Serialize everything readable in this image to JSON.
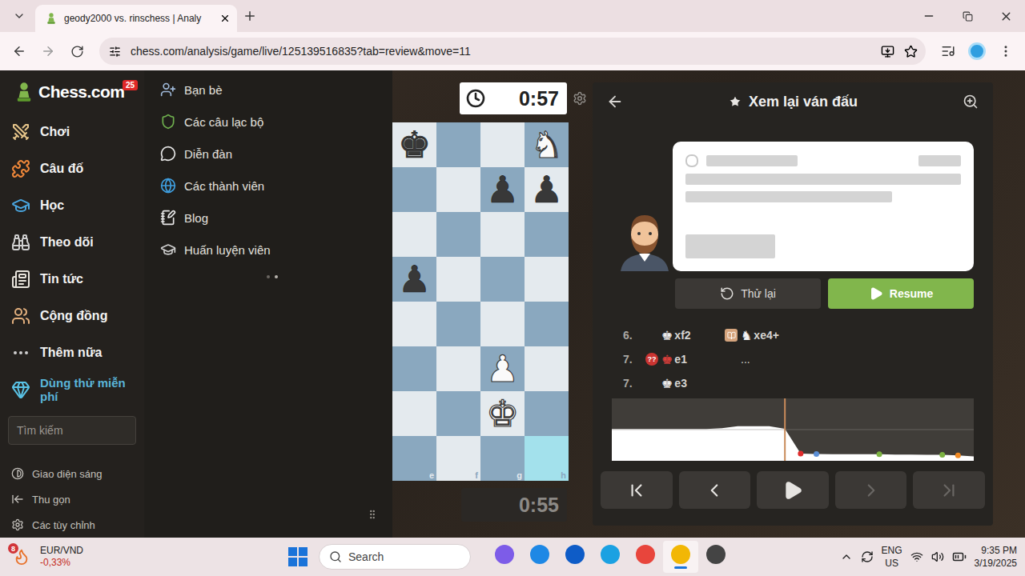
{
  "browser": {
    "tab": {
      "title": "geody2000 vs. rinschess | Analy"
    },
    "url": "chess.com/analysis/game/live/125139516835?tab=review&move=11"
  },
  "sidebar": {
    "logo": "Chess.com",
    "badge": "25",
    "items": [
      {
        "label": "Chơi"
      },
      {
        "label": "Câu đố"
      },
      {
        "label": "Học"
      },
      {
        "label": "Theo dõi"
      },
      {
        "label": "Tin tức"
      },
      {
        "label": "Cộng đồng"
      },
      {
        "label": "Thêm nữa"
      }
    ],
    "trial": "Dùng thử miễn phí",
    "search_placeholder": "Tìm kiếm",
    "footer": [
      {
        "label": "Giao diện sáng"
      },
      {
        "label": "Thu gọn"
      },
      {
        "label": "Các tùy chỉnh"
      }
    ]
  },
  "submenu": [
    {
      "label": "Bạn bè"
    },
    {
      "label": "Các câu lạc bộ"
    },
    {
      "label": "Diễn đàn"
    },
    {
      "label": "Các thành viên"
    },
    {
      "label": "Blog"
    },
    {
      "label": "Huấn luyện viên"
    }
  ],
  "clocks": {
    "top": "0:57",
    "bottom": "0:55"
  },
  "board": {
    "files": [
      "e",
      "f",
      "g",
      "h"
    ],
    "highlight": [
      "h1"
    ],
    "pieces": [
      {
        "square": "e8",
        "glyph": "♚",
        "side": "black"
      },
      {
        "square": "h8",
        "glyph": "♞",
        "side": "white"
      },
      {
        "square": "g7",
        "glyph": "♟",
        "side": "black"
      },
      {
        "square": "h7",
        "glyph": "♟",
        "side": "black"
      },
      {
        "square": "e5",
        "glyph": "♟",
        "side": "black"
      },
      {
        "square": "g3",
        "glyph": "♟",
        "side": "white"
      },
      {
        "square": "g2",
        "glyph": "♚",
        "side": "white"
      }
    ]
  },
  "review": {
    "title": "Xem lại ván đấu",
    "buttons": [
      {
        "label": "Thử lại",
        "kind": "retry"
      },
      {
        "label": "Resume",
        "kind": "resume"
      }
    ],
    "moves": [
      {
        "number": "6.",
        "white": {
          "badge": "",
          "quality": "normal",
          "figure": "♚",
          "san": "xf2"
        },
        "black": {
          "badge": "",
          "quality": "book",
          "figure": "♞",
          "san": "xe4+"
        }
      },
      {
        "number": "7.",
        "white": {
          "badge": "??",
          "quality": "blunder",
          "figure": "♚",
          "san": "e1"
        },
        "black": {
          "badge": "",
          "quality": "normal",
          "figure": "",
          "san": "..."
        }
      },
      {
        "number": "7.",
        "white": {
          "badge": "",
          "quality": "normal",
          "figure": "♚",
          "san": "e3"
        },
        "black": null
      }
    ],
    "graph": {
      "values": [
        0.2,
        0.2,
        0.2,
        0.2,
        0.2,
        0.2,
        0.2,
        0.5,
        1.2,
        1.2,
        1.2,
        0.3,
        -8.6,
        -8.7,
        -8.8,
        -8.8,
        -8.8,
        -8.8,
        -8.9,
        -8.9,
        -9,
        -9,
        -9.2,
        -9.6
      ],
      "current": 11,
      "markers": [
        {
          "index": 12,
          "color": "#e02c2c"
        },
        {
          "index": 13,
          "color": "#5b8fd6"
        },
        {
          "index": 17,
          "color": "#7cb342"
        },
        {
          "index": 21,
          "color": "#7cb342"
        },
        {
          "index": 22,
          "color": "#f08a24"
        }
      ]
    },
    "nav": [
      {
        "kind": "first",
        "disabled": false
      },
      {
        "kind": "prev",
        "disabled": false
      },
      {
        "kind": "play",
        "disabled": false
      },
      {
        "kind": "next",
        "disabled": true
      },
      {
        "kind": "last",
        "disabled": true
      }
    ]
  },
  "taskbar": {
    "ticker": {
      "symbol": "EUR/VND",
      "change": "-0,33%",
      "badge": "8"
    },
    "search_placeholder": "Search",
    "lang": "ENG",
    "region": "US",
    "time": "9:35 PM",
    "date": "3/19/2025"
  }
}
